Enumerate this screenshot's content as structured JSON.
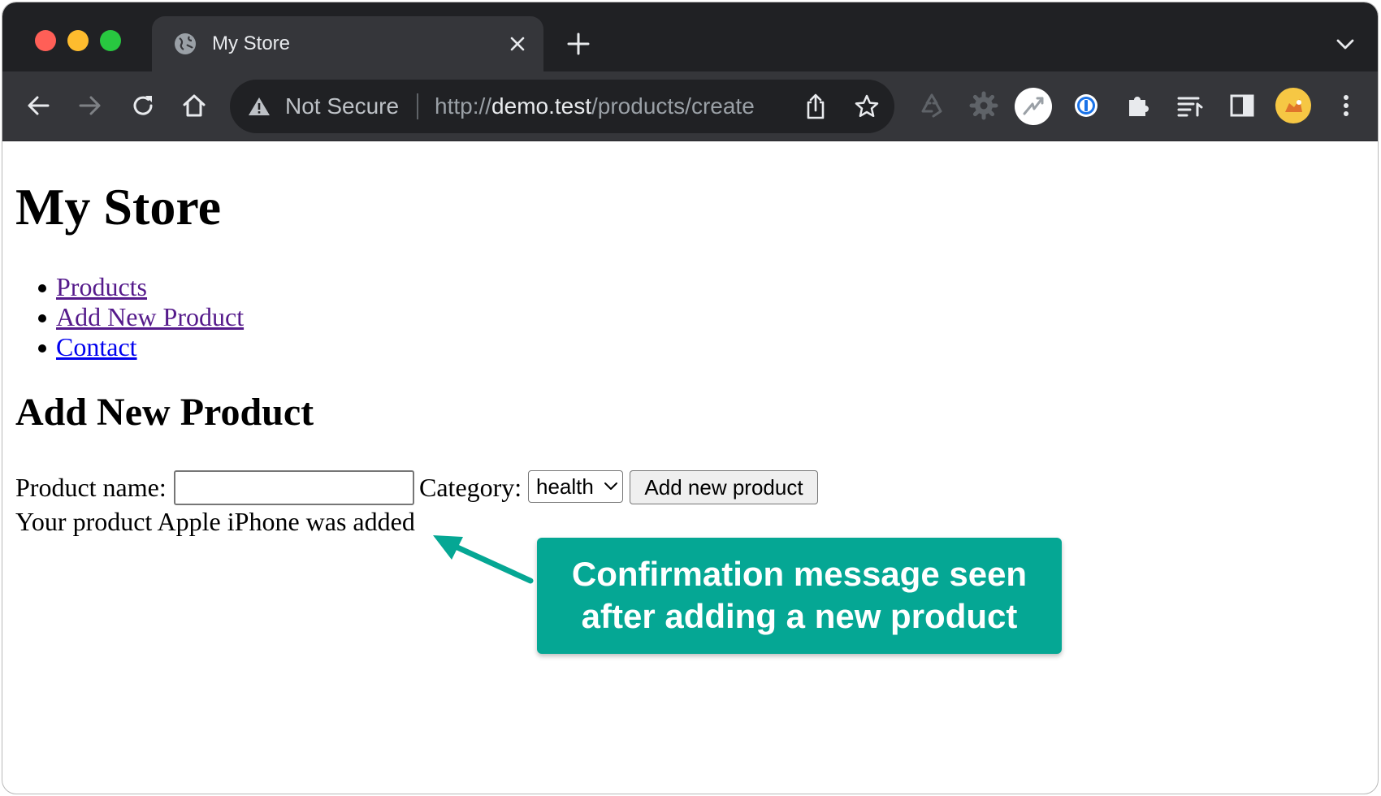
{
  "browser": {
    "tab_title": "My Store",
    "omnibox": {
      "security_label": "Not Secure",
      "url_scheme": "http://",
      "url_host": "demo.test",
      "url_path": "/products/create"
    }
  },
  "page": {
    "site_title": "My Store",
    "nav": [
      {
        "label": "Products",
        "visited": true
      },
      {
        "label": "Add New Product",
        "visited": true
      },
      {
        "label": "Contact",
        "visited": false
      }
    ],
    "section_title": "Add New Product",
    "form": {
      "name_label": "Product name:",
      "name_value": "",
      "category_label": "Category:",
      "category_selected": "health",
      "submit_label": "Add new product"
    },
    "confirmation": "Your product Apple iPhone was added"
  },
  "annotation": {
    "lines": [
      "Confirmation message seen",
      "after adding a new product"
    ],
    "color": "#05a794"
  }
}
